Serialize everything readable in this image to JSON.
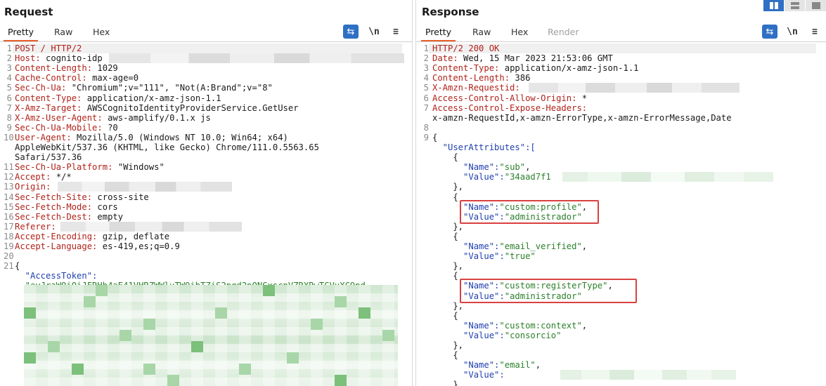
{
  "request": {
    "title": "Request",
    "tabs": [
      "Pretty",
      "Raw",
      "Hex"
    ],
    "tools": {
      "wrap": "⇆",
      "newline": "\\n",
      "menu": "≡"
    },
    "lines": [
      {
        "n": "1",
        "key": "POST / HTTP/2",
        "val": ""
      },
      {
        "n": "2",
        "key": "Host:",
        "val": " cognito-idp"
      },
      {
        "n": "3",
        "key": "Content-Length:",
        "val": " 1029"
      },
      {
        "n": "4",
        "key": "Cache-Control:",
        "val": " max-age=0"
      },
      {
        "n": "5",
        "key": "Sec-Ch-Ua:",
        "val": " \"Chromium\";v=\"111\", \"Not(A:Brand\";v=\"8\""
      },
      {
        "n": "6",
        "key": "Content-Type:",
        "val": " application/x-amz-json-1.1"
      },
      {
        "n": "7",
        "key": "X-Amz-Target:",
        "val": " AWSCognitoIdentityProviderService.GetUser"
      },
      {
        "n": "8",
        "key": "X-Amz-User-Agent:",
        "val": " aws-amplify/0.1.x js"
      },
      {
        "n": "9",
        "key": "Sec-Ch-Ua-Mobile:",
        "val": " ?0"
      },
      {
        "n": "10",
        "key": "User-Agent:",
        "val": " Mozilla/5.0 (Windows NT 10.0; Win64; x64)"
      },
      {
        "n": "",
        "key": "",
        "val": "AppleWebKit/537.36 (KHTML, like Gecko) Chrome/111.0.5563.65"
      },
      {
        "n": "",
        "key": "",
        "val": "Safari/537.36"
      },
      {
        "n": "11",
        "key": "Sec-Ch-Ua-Platform:",
        "val": " \"Windows\""
      },
      {
        "n": "12",
        "key": "Accept:",
        "val": " */*"
      },
      {
        "n": "13",
        "key": "Origin:",
        "val": ""
      },
      {
        "n": "14",
        "key": "Sec-Fetch-Site:",
        "val": " cross-site"
      },
      {
        "n": "15",
        "key": "Sec-Fetch-Mode:",
        "val": " cors"
      },
      {
        "n": "16",
        "key": "Sec-Fetch-Dest:",
        "val": " empty"
      },
      {
        "n": "17",
        "key": "Referer:",
        "val": ""
      },
      {
        "n": "18",
        "key": "Accept-Encoding:",
        "val": " gzip, deflate"
      },
      {
        "n": "19",
        "key": "Accept-Language:",
        "val": " es-419,es;q=0.9"
      },
      {
        "n": "20",
        "key": "",
        "val": ""
      },
      {
        "n": "21",
        "key": "",
        "val": "{"
      },
      {
        "n": "",
        "key": "",
        "val": "  \"AccessToken\":",
        "json": "key"
      },
      {
        "n": "",
        "key": "",
        "val": "  \"eyJraWQiOiJFRHh4aE41VHRZWWluTW9ibTZiS2pqd2pONGxscnVZRXRwTGVuXC9pd",
        "json": "val"
      }
    ]
  },
  "response": {
    "title": "Response",
    "tabs": [
      "Pretty",
      "Raw",
      "Hex",
      "Render"
    ],
    "tools": {
      "wrap": "⇆",
      "newline": "\\n",
      "menu": "≡"
    },
    "lines": [
      {
        "n": "1",
        "key": "HTTP/2 200 OK",
        "val": ""
      },
      {
        "n": "2",
        "key": "Date:",
        "val": " Wed, 15 Mar 2023 21:53:06 GMT"
      },
      {
        "n": "3",
        "key": "Content-Type:",
        "val": " application/x-amz-json-1.1"
      },
      {
        "n": "4",
        "key": "Content-Length:",
        "val": " 386"
      },
      {
        "n": "5",
        "key": "X-Amzn-Requestid:",
        "val": ""
      },
      {
        "n": "6",
        "key": "Access-Control-Allow-Origin:",
        "val": " *"
      },
      {
        "n": "7",
        "key": "Access-Control-Expose-Headers:",
        "val": ""
      },
      {
        "n": "",
        "key": "",
        "val": "x-amzn-RequestId,x-amzn-ErrorType,x-amzn-ErrorMessage,Date"
      },
      {
        "n": "8",
        "key": "",
        "val": ""
      },
      {
        "n": "9",
        "key": "",
        "val": "{"
      },
      {
        "n": "",
        "json": "key",
        "val": "  \"UserAttributes\":["
      },
      {
        "n": "",
        "val": "    {"
      },
      {
        "n": "",
        "jk": "      \"Name\":",
        "jv": "\"sub\"",
        "tail": ","
      },
      {
        "n": "",
        "jk": "      \"Value\":",
        "jv": "\"34aad7f1",
        "tail": ""
      },
      {
        "n": "",
        "val": "    },"
      },
      {
        "n": "",
        "val": "    {"
      },
      {
        "n": "",
        "jk": "      \"Name\":",
        "jv": "\"custom:profile\"",
        "tail": ","
      },
      {
        "n": "",
        "jk": "      \"Value\":",
        "jv": "\"administrador\"",
        "tail": ""
      },
      {
        "n": "",
        "val": "    },"
      },
      {
        "n": "",
        "val": "    {"
      },
      {
        "n": "",
        "jk": "      \"Name\":",
        "jv": "\"email_verified\"",
        "tail": ","
      },
      {
        "n": "",
        "jk": "      \"Value\":",
        "jv": "\"true\"",
        "tail": ""
      },
      {
        "n": "",
        "val": "    },"
      },
      {
        "n": "",
        "val": "    {"
      },
      {
        "n": "",
        "jk": "      \"Name\":",
        "jv": "\"custom:registerType\"",
        "tail": ","
      },
      {
        "n": "",
        "jk": "      \"Value\":",
        "jv": "\"administrador\"",
        "tail": ""
      },
      {
        "n": "",
        "val": "    },"
      },
      {
        "n": "",
        "val": "    {"
      },
      {
        "n": "",
        "jk": "      \"Name\":",
        "jv": "\"custom:context\"",
        "tail": ","
      },
      {
        "n": "",
        "jk": "      \"Value\":",
        "jv": "\"consorcio\"",
        "tail": ""
      },
      {
        "n": "",
        "val": "    },"
      },
      {
        "n": "",
        "val": "    {"
      },
      {
        "n": "",
        "jk": "      \"Name\":",
        "jv": "\"email\"",
        "tail": ","
      },
      {
        "n": "",
        "jk": "      \"Value\":",
        "jv": "",
        "tail": ""
      },
      {
        "n": "",
        "val": "    }"
      }
    ]
  },
  "colors": {
    "accent": "#e8602c",
    "toolbar_active": "#2f6fc4",
    "highlight_box": "#d9413f",
    "header_key": "#b0221a",
    "json_key": "#1f3fae",
    "json_value": "#2a7f2a"
  }
}
